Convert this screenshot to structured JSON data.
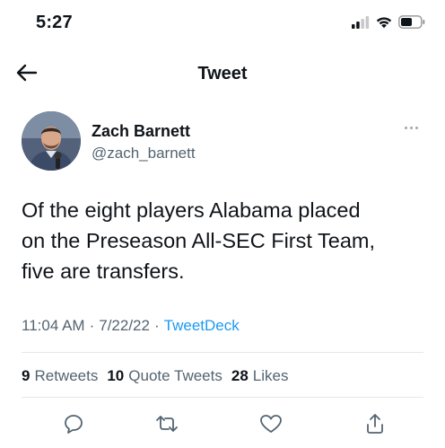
{
  "status_bar": {
    "time": "5:27",
    "icons": [
      "cellular-signal-icon",
      "wifi-icon",
      "battery-icon"
    ]
  },
  "header": {
    "back_icon": "arrow-left-icon",
    "title": "Tweet"
  },
  "tweet": {
    "author": {
      "name": "Zach Barnett",
      "handle": "@zach_barnett"
    },
    "text": "Of the eight players Alabama placed\non the Preseason All-SEC First Team,\nfive are transfers.",
    "time": "11:04 AM",
    "separator": "·",
    "date": "7/22/22",
    "source": "TweetDeck",
    "stats": {
      "retweets_count": "9",
      "retweets_label": "Retweets",
      "quote_count": "10",
      "quote_label": "Quote Tweets",
      "likes_count": "28",
      "likes_label": "Likes"
    },
    "actions": [
      "reply-icon",
      "retweet-icon",
      "like-icon",
      "share-icon"
    ]
  },
  "colors": {
    "text_primary": "#0f1419",
    "text_secondary": "#536471",
    "link": "#1d9bf0",
    "divider": "#e4e7ea"
  }
}
